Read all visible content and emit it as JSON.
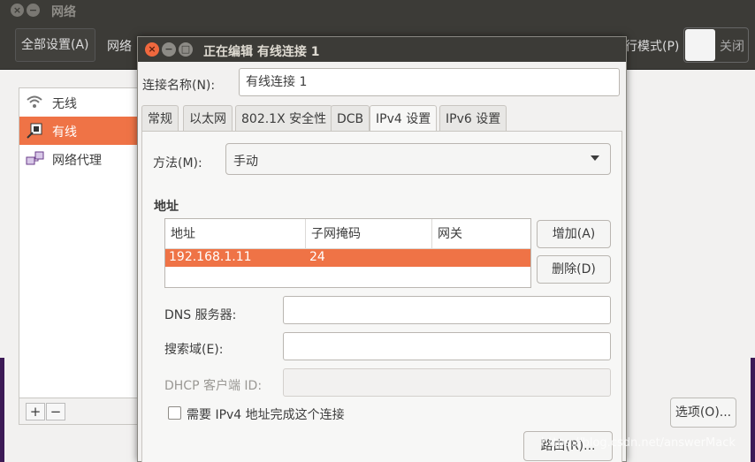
{
  "background_window": {
    "title": "网络",
    "toolbar": {
      "all_settings": "全部设置(A)",
      "network": "网络",
      "airplane_mode": "行模式(P)",
      "toggle_state": "关闭"
    },
    "sidebar": [
      {
        "label": "无线",
        "icon": "wifi-icon"
      },
      {
        "label": "有线",
        "icon": "wired-icon",
        "selected": true
      },
      {
        "label": "网络代理",
        "icon": "proxy-icon"
      }
    ],
    "add": "+",
    "remove": "−",
    "options_button": "选项(O)..."
  },
  "dialog": {
    "title": "正在编辑 有线连接 1",
    "connection_name_label": "连接名称(N):",
    "connection_name_value": "有线连接 1",
    "tabs": [
      "常规",
      "以太网",
      "802.1X 安全性",
      "DCB",
      "IPv4 设置",
      "IPv6 设置"
    ],
    "active_tab": "IPv4 设置",
    "method_label": "方法(M):",
    "method_value": "手动",
    "addresses_heading": "地址",
    "table": {
      "columns": [
        "地址",
        "子网掩码",
        "网关"
      ],
      "rows": [
        {
          "address": "192.168.1.11",
          "netmask": "24",
          "gateway": ""
        }
      ]
    },
    "add_button": "增加(A)",
    "delete_button": "删除(D)",
    "dns_label": "DNS 服务器:",
    "dns_value": "",
    "search_domain_label": "搜索域(E):",
    "search_domain_value": "",
    "dhcp_client_id_label": "DHCP 客户端 ID:",
    "dhcp_client_id_value": "",
    "require_ipv4_label": "需要 IPv4 地址完成这个连接",
    "routes_button": "路由(R)..."
  },
  "watermark": "https://blog.csdn.net/answerMack"
}
